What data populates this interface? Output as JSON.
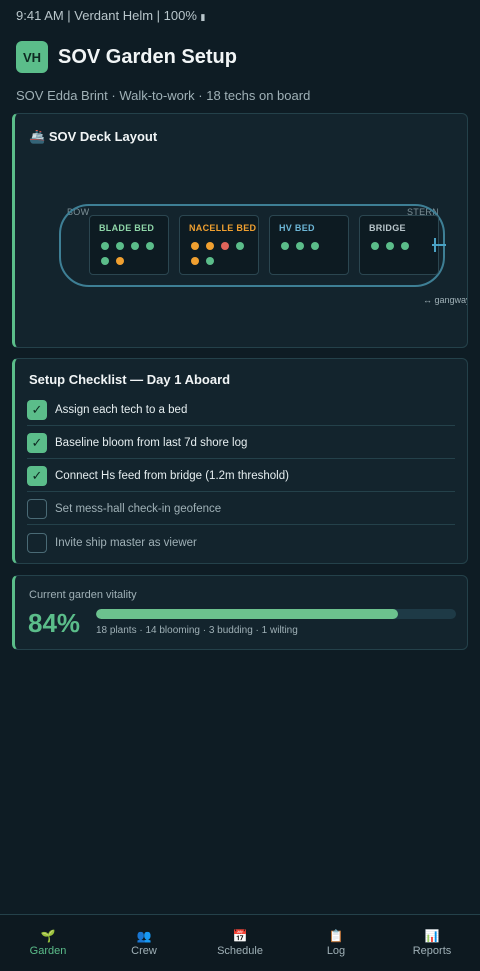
{
  "status_bar": {
    "text": "9:41 AM | Verdant Helm | 100%",
    "battery_glyph": "▮"
  },
  "header": {
    "avatar_initials": "VH",
    "title": "SOV Garden Setup"
  },
  "subtitle": "SOV Edda Brint · Walk-to-work · 18 techs on board",
  "deck": {
    "icon": "🚢",
    "title": "SOV Deck Layout",
    "bow_label": "BOW",
    "stern_label": "STERN",
    "gangway_label": "↔ gangway",
    "beds": [
      {
        "name": "BLADE BED",
        "color": "#8fd6a8",
        "plants": [
          "healthy",
          "healthy",
          "healthy",
          "healthy",
          "healthy",
          "budding"
        ]
      },
      {
        "name": "NACELLE BED",
        "color": "#f0a030",
        "plants": [
          "budding",
          "budding",
          "wilting",
          "healthy",
          "budding",
          "healthy"
        ]
      },
      {
        "name": "HV BED",
        "color": "#6cb6d6",
        "plants": [
          "healthy",
          "healthy",
          "healthy"
        ]
      },
      {
        "name": "BRIDGE",
        "color": "#b9c6cb",
        "plants": [
          "healthy",
          "healthy",
          "healthy"
        ]
      }
    ],
    "status_colors": {
      "healthy": "#5bbd8a",
      "budding": "#f0a030",
      "wilting": "#e0645a"
    }
  },
  "checklist": {
    "title": "Setup Checklist — Day 1 Aboard",
    "items": [
      {
        "label": "Assign each tech to a bed",
        "done": true
      },
      {
        "label": "Baseline bloom from last 7d shore log",
        "done": true
      },
      {
        "label": "Connect Hs feed from bridge (1.2m threshold)",
        "done": true
      },
      {
        "label": "Set mess-hall check-in geofence",
        "done": false
      },
      {
        "label": "Invite ship master as viewer",
        "done": false
      }
    ],
    "check_glyph": "✓"
  },
  "vitality": {
    "label": "Current garden vitality",
    "percent_text": "84%",
    "fraction": 0.84,
    "meta": "18 plants · 14 blooming · 3 budding · 1 wilting"
  },
  "nav": {
    "items": [
      {
        "icon": "🌱",
        "label": "Garden",
        "active": true
      },
      {
        "icon": "👥",
        "label": "Crew",
        "active": false
      },
      {
        "icon": "📅",
        "label": "Schedule",
        "active": false
      },
      {
        "icon": "📋",
        "label": "Log",
        "active": false
      },
      {
        "icon": "📊",
        "label": "Reports",
        "active": false
      }
    ]
  }
}
